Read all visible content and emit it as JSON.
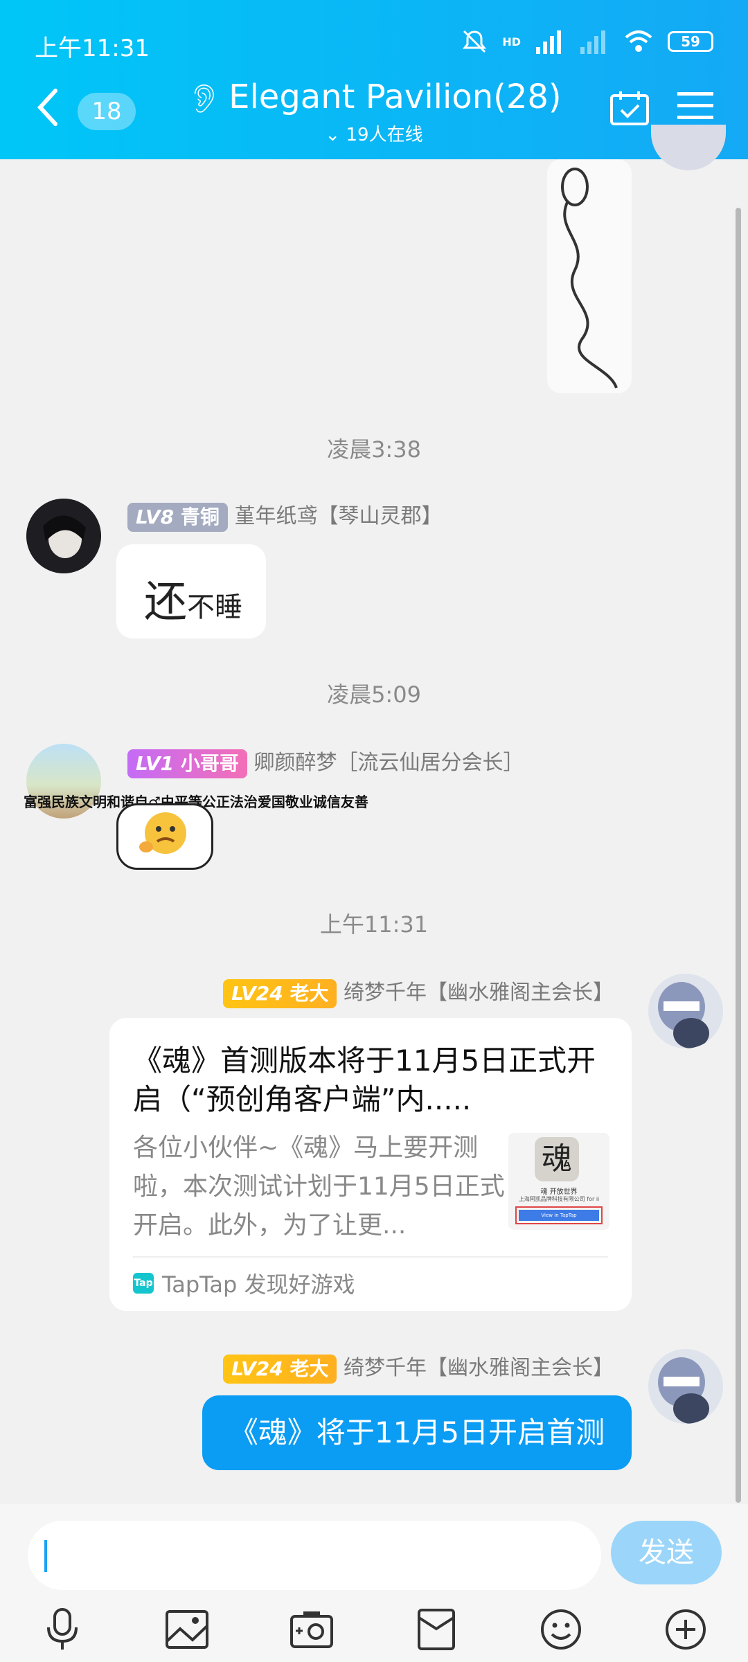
{
  "status_bar": {
    "time": "上午11:31",
    "network": "HD",
    "battery": "59"
  },
  "header": {
    "unread_count": "18",
    "title": "Elegant Pavilion(28)",
    "online": "19人在线"
  },
  "messages": {
    "time1": "凌晨3:38",
    "m1": {
      "level": "LV8",
      "rank": "青铜",
      "name": "堇年纸鸢【琴山灵郡】",
      "text_big": "还",
      "text_small": "不睡"
    },
    "time2": "凌晨5:09",
    "m2": {
      "level": "LV1",
      "rank": "小哥哥",
      "name": "卿颜醉梦［流云仙居分会长］",
      "avatar_text": "富强民族文明和谐自♂由平等公正法治爱国敬业诚信友善"
    },
    "time3": "上午11:31",
    "m3": {
      "level": "LV24",
      "rank": "老大",
      "name": "绮梦千年【幽水雅阁主会长】",
      "card_title": "《魂》首测版本将于11月5日正式开启（“预创角客户端”内.....",
      "card_desc": "各位小伙伴~《魂》马上要开测啦，本次测试计划于11月5日正式开启。此外，为了让更...",
      "thumb_char": "魂",
      "thumb_caption": "魂 开放世界",
      "thumb_company": "上海阿凯品牌科技有限公司 for ii",
      "thumb_button": "View in TapTap",
      "source_logo": "Tap",
      "source": "TapTap 发现好游戏"
    },
    "m4": {
      "level": "LV24",
      "rank": "老大",
      "name": "绮梦千年【幽水雅阁主会长】",
      "text": "《魂》将于11月5日开启首测"
    }
  },
  "input": {
    "send_label": "发送"
  }
}
